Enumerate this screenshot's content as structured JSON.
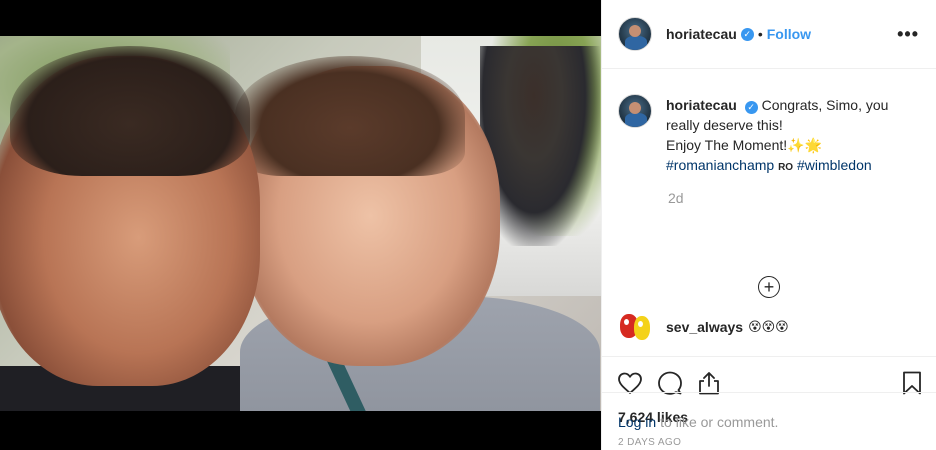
{
  "header": {
    "username": "horiatecau",
    "separator": "•",
    "follow_label": "Follow",
    "more_label": "•••"
  },
  "caption": {
    "username": "horiatecau",
    "line1": "Congrats, Simo, you",
    "line2": "really deserve this!",
    "line3": "Enjoy The Moment!✨🌟",
    "hashtag1": "#romanianchamp",
    "flag": "RO",
    "hashtag2": "#wimbledon",
    "time": "2d"
  },
  "load_more_label": "+",
  "comment": {
    "username": "sev_always",
    "text": "😵😵😵"
  },
  "likes": "7,624 likes",
  "date": "2 DAYS AGO",
  "login": {
    "link": "Log in",
    "rest": "to like or comment."
  },
  "icons": [
    "heart-icon",
    "comment-icon",
    "share-icon",
    "bookmark-icon",
    "verified-icon",
    "more-options-icon",
    "add-comments-icon"
  ],
  "colors": {
    "link_blue": "#3897f0",
    "hashtag": "#003569",
    "muted": "#999999",
    "border": "#efefef"
  }
}
